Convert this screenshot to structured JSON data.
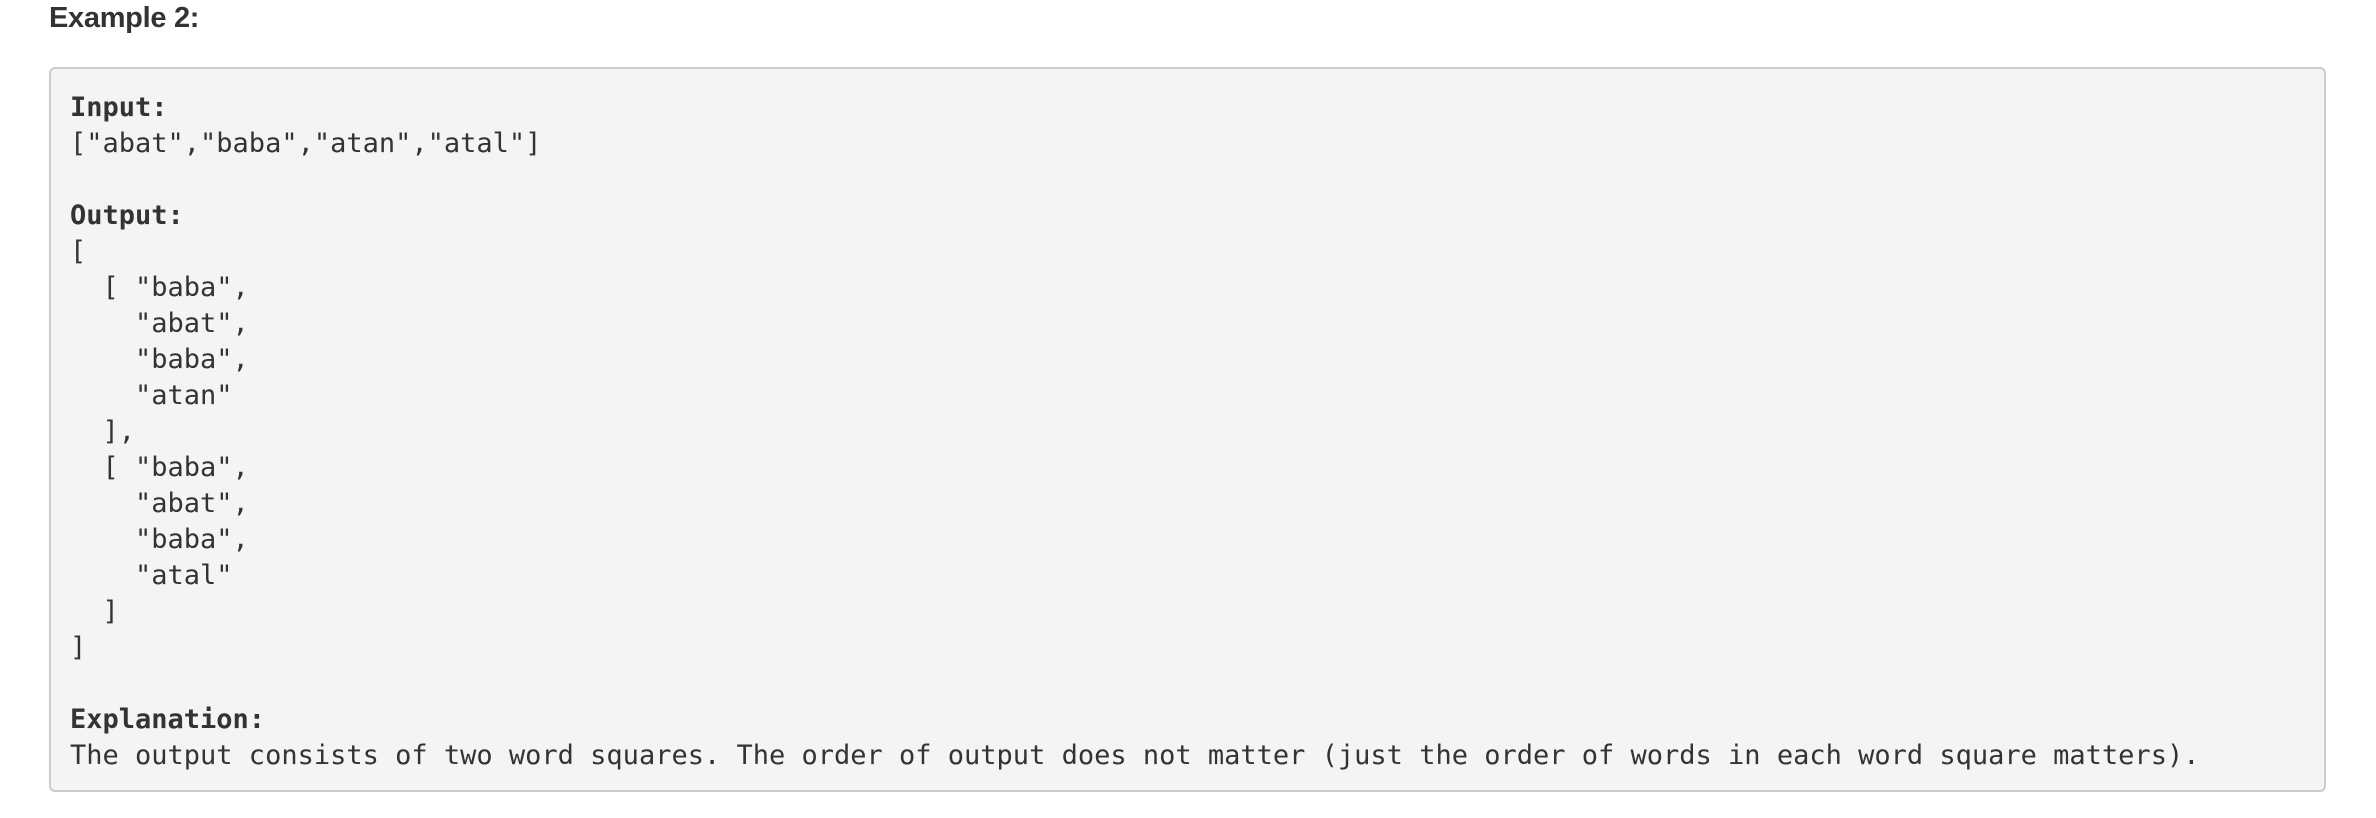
{
  "heading": "Example 2:",
  "example": {
    "input_label": "Input:",
    "input_value": "[\"abat\",\"baba\",\"atan\",\"atal\"]",
    "output_label": "Output:",
    "output_lines": [
      "[",
      "  [ \"baba\",",
      "    \"abat\",",
      "    \"baba\",",
      "    \"atan\"",
      "  ],",
      "  [ \"baba\",",
      "    \"abat\",",
      "    \"baba\",",
      "    \"atal\"",
      "  ]",
      "]"
    ],
    "explanation_label": "Explanation:",
    "explanation_text": "The output consists of two word squares. The order of output does not matter (just the order of words in each word square matters)."
  }
}
